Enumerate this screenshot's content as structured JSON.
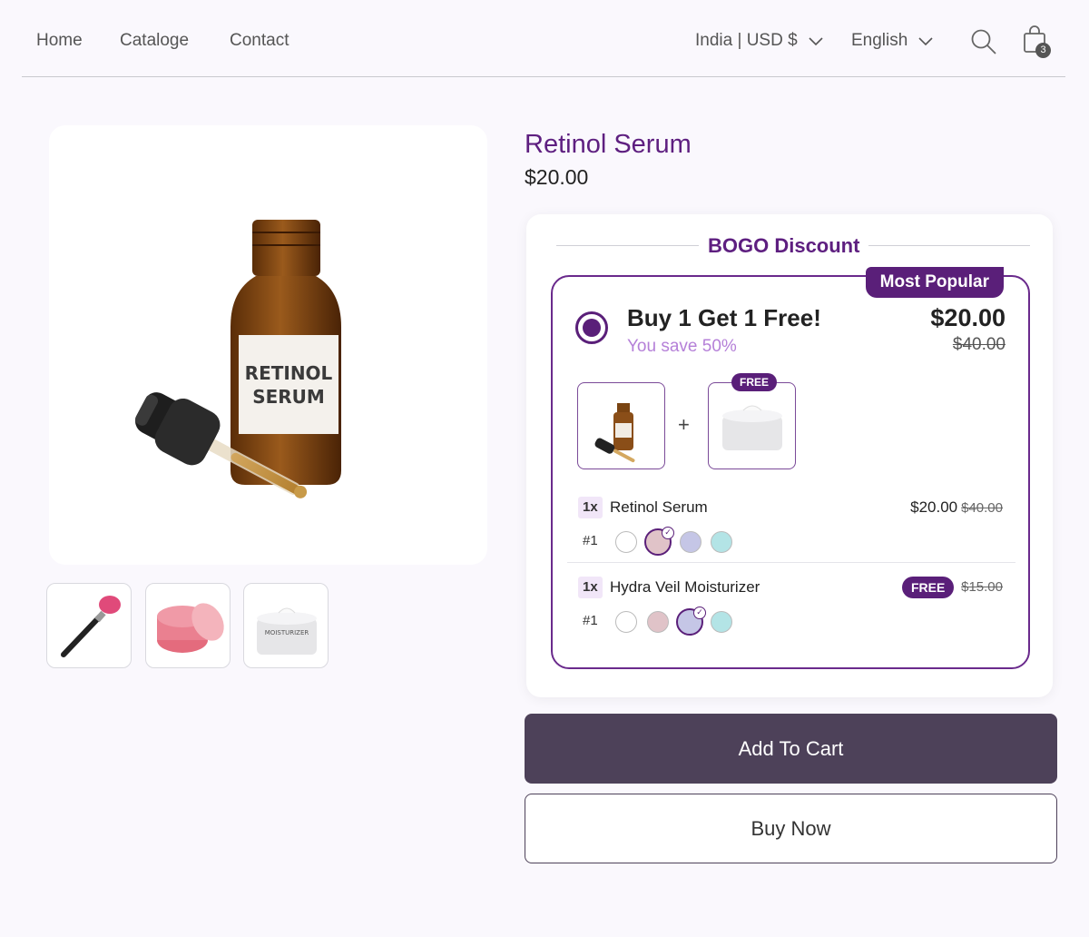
{
  "nav": {
    "links": [
      "Home",
      "Cataloge",
      "Contact"
    ],
    "region": "India | USD $",
    "language": "English",
    "cart_count": "3"
  },
  "product": {
    "title": "Retinol Serum",
    "price": "$20.00",
    "bottle_label_line1": "RETINOL",
    "bottle_label_line2": "SERUM"
  },
  "bogo": {
    "heading": "BOGO Discount",
    "badge": "Most Popular",
    "offer_title": "Buy 1 Get 1 Free!",
    "offer_savings": "You save 50%",
    "offer_price": "$20.00",
    "offer_compare_price": "$40.00",
    "free_tag": "FREE",
    "items": [
      {
        "qty": "1x",
        "name": "Retinol Serum",
        "price": "$20.00",
        "compare_price": "$40.00",
        "variant_label": "#1",
        "selected_swatch": 1
      },
      {
        "qty": "1x",
        "name": "Hydra Veil Moisturizer",
        "price_badge": "FREE",
        "compare_price": "$15.00",
        "variant_label": "#1",
        "selected_swatch": 2
      }
    ],
    "swatch_colors": [
      "#ffffff",
      "#e0c3c8",
      "#c5c6e6",
      "#b3e4e6"
    ]
  },
  "buttons": {
    "add_to_cart": "Add To Cart",
    "buy_now": "Buy Now"
  },
  "jar_label": "MOISTURIZER",
  "colors": {
    "brand_purple": "#5a1f79",
    "title_purple": "#5e1f80",
    "savings_purple": "#b580d8",
    "cart_button": "#4d4159"
  }
}
